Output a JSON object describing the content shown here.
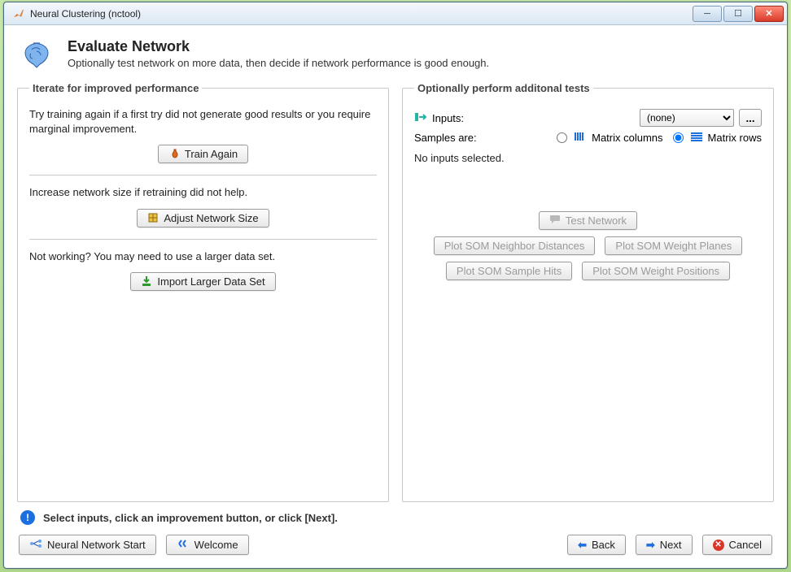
{
  "window": {
    "title": "Neural Clustering (nctool)"
  },
  "header": {
    "title": "Evaluate Network",
    "subtitle": "Optionally test network on more data, then decide if network performance is good enough."
  },
  "left": {
    "legend": "Iterate for improved performance",
    "train_text": "Try training again if a first try did not generate good results or you require marginal improvement.",
    "train_btn": "Train Again",
    "adjust_text": "Increase network size if retraining did not help.",
    "adjust_btn": "Adjust Network Size",
    "import_text": "Not working? You may need to use a larger data set.",
    "import_btn": "Import Larger Data Set"
  },
  "right": {
    "legend": "Optionally perform additonal tests",
    "inputs_label": "Inputs:",
    "inputs_value": "(none)",
    "browse": "...",
    "samples_label": "Samples are:",
    "radio_cols": "Matrix columns",
    "radio_rows": "Matrix rows",
    "selected_radio": "rows",
    "status": "No inputs selected.",
    "test_btn": "Test Network",
    "plot1": "Plot SOM Neighbor Distances",
    "plot2": "Plot SOM Weight Planes",
    "plot3": "Plot SOM Sample Hits",
    "plot4": "Plot SOM Weight Positions"
  },
  "footer": {
    "tip": "Select inputs, click an improvement button, or click [Next].",
    "nn_start": "Neural Network Start",
    "welcome": "Welcome",
    "back": "Back",
    "next": "Next",
    "cancel": "Cancel"
  }
}
